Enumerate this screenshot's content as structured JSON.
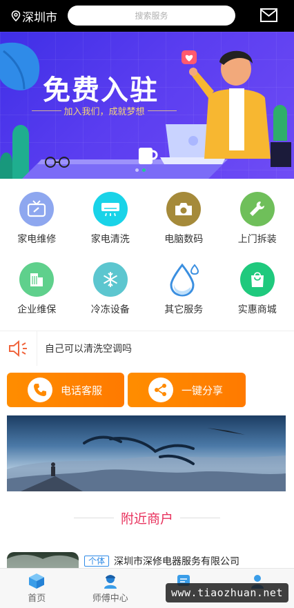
{
  "header": {
    "location": "深圳市",
    "search_placeholder": "搜索服务"
  },
  "banner": {
    "title": "免费入驻",
    "subtitle": "加入我们，成就梦想",
    "slides": 2,
    "active_slide": 2
  },
  "services": [
    {
      "label": "家电维修",
      "icon": "tv-repair-icon",
      "color": "#8ea7ef"
    },
    {
      "label": "家电清洗",
      "icon": "air-conditioner-icon",
      "color": "#19d3e8"
    },
    {
      "label": "电脑数码",
      "icon": "camera-icon",
      "color": "#a58a3a"
    },
    {
      "label": "上门拆装",
      "icon": "wrench-icon",
      "color": "#6fbf5a"
    },
    {
      "label": "企业维保",
      "icon": "building-icon",
      "color": "#5fd08c"
    },
    {
      "label": "冷冻设备",
      "icon": "snowflake-icon",
      "color": "#5cc6cf"
    },
    {
      "label": "其它服务",
      "icon": "water-drop-icon",
      "color": "#3b8fe0"
    },
    {
      "label": "实惠商城",
      "icon": "shopping-bag-icon",
      "color": "#1fc97d"
    }
  ],
  "notice": {
    "text": "自己可以清洗空调吗"
  },
  "actions": {
    "phone_label": "电话客服",
    "share_label": "一键分享"
  },
  "section": {
    "title": "附近商户"
  },
  "merchant": {
    "tag": "个体",
    "name": "深圳市深修电器服务有限公司"
  },
  "tabbar": [
    {
      "label": "首页",
      "icon": "home-cube-icon"
    },
    {
      "label": "师傅中心",
      "icon": "worker-icon"
    },
    {
      "label": "",
      "icon": "message-icon"
    },
    {
      "label": "",
      "icon": "user-icon"
    }
  ],
  "watermark": "www.tiaozhuan.net",
  "colors": {
    "accent_orange": "#ff8a00",
    "section_title": "#e8315c",
    "tag_blue": "#2e8ae6",
    "banner_purple": "#4f38ee"
  }
}
